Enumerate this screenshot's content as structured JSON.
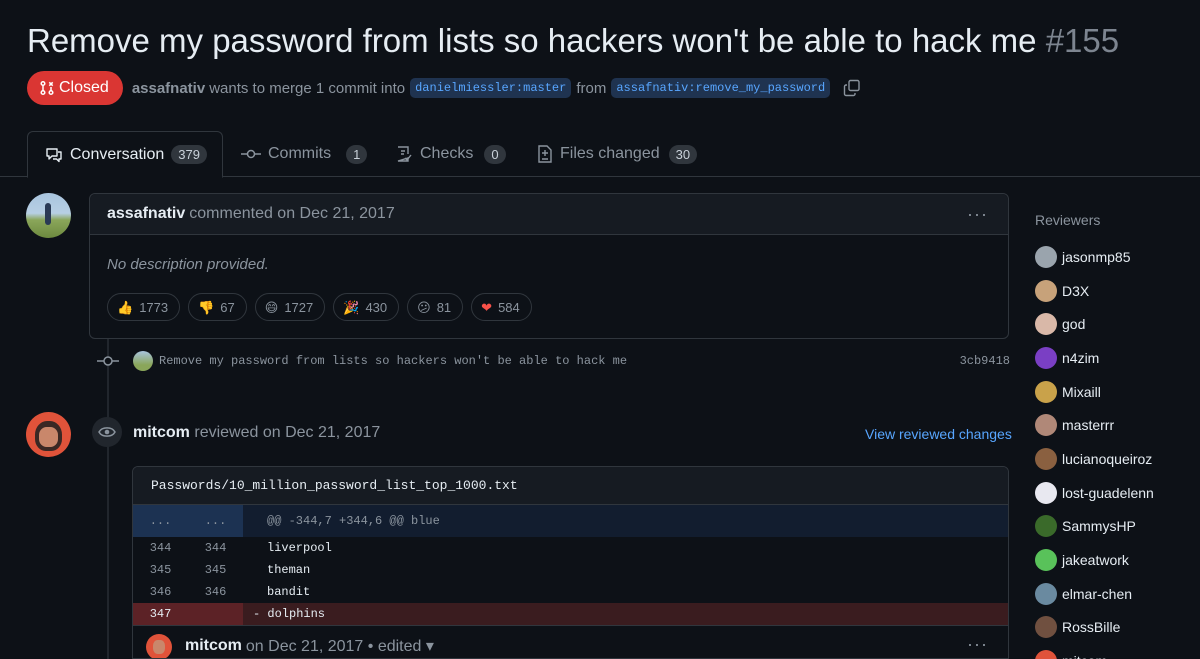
{
  "pr": {
    "title": "Remove my password from lists so hackers won't be able to hack me",
    "number": "#155",
    "state": "Closed",
    "author": "assafnativ",
    "merge_text": "wants to merge 1 commit into",
    "base_branch": "danielmiessler:master",
    "from_text": "from",
    "head_branch": "assafnativ:remove_my_password"
  },
  "tabs": [
    {
      "label": "Conversation",
      "count": "379",
      "icon": "conversation-icon"
    },
    {
      "label": "Commits",
      "count": "1",
      "icon": "commit-icon"
    },
    {
      "label": "Checks",
      "count": "0",
      "icon": "checklist-icon"
    },
    {
      "label": "Files changed",
      "count": "30",
      "icon": "file-diff-icon"
    }
  ],
  "comment": {
    "author": "assafnativ",
    "meta": "commented on Dec 21, 2017",
    "menu": "···",
    "body": "No description provided.",
    "reactions": [
      {
        "emoji": "👍",
        "count": "1773",
        "name": "thumbs-up"
      },
      {
        "emoji": "👎",
        "count": "67",
        "name": "thumbs-down"
      },
      {
        "emoji": "😄",
        "count": "1727",
        "name": "laugh"
      },
      {
        "emoji": "🎉",
        "count": "430",
        "name": "hooray"
      },
      {
        "emoji": "😕",
        "count": "81",
        "name": "confused"
      },
      {
        "emoji": "❤",
        "count": "584",
        "name": "heart"
      }
    ]
  },
  "commit": {
    "message": "Remove my password from lists so hackers won't be able to hack me",
    "sha": "3cb9418"
  },
  "review": {
    "author": "mitcom",
    "meta": "reviewed on Dec 21, 2017",
    "link": "View reviewed changes",
    "file": "Passwords/10_million_password_list_top_1000.txt",
    "hunk": {
      "left": "...",
      "right": "...",
      "header": "@@ -344,7 +344,6 @@ blue"
    },
    "lines": [
      {
        "old": "344",
        "new": "344",
        "code": "liverpool"
      },
      {
        "old": "345",
        "new": "345",
        "code": "theman"
      },
      {
        "old": "346",
        "new": "346",
        "code": "bandit"
      }
    ],
    "deleted": {
      "old": "347",
      "new": "",
      "code": "- dolphins"
    },
    "sub_comment": {
      "author": "mitcom",
      "meta": "on Dec 21, 2017 • edited ▾",
      "menu": "···"
    }
  },
  "sidebar": {
    "title": "Reviewers",
    "reviewers": [
      {
        "name": "jasonmp85",
        "color": "#9aa4ad"
      },
      {
        "name": "D3X",
        "color": "#c7a27a"
      },
      {
        "name": "god",
        "color": "#d9b8a8"
      },
      {
        "name": "n4zim",
        "color": "#7a3fc4"
      },
      {
        "name": "Mixaill",
        "color": "#c9a24a"
      },
      {
        "name": "masterrr",
        "color": "#b08878"
      },
      {
        "name": "lucianoqueiroz",
        "color": "#8a6040"
      },
      {
        "name": "lost-guadelenn",
        "color": "#e8e8f0"
      },
      {
        "name": "SammysHP",
        "color": "#3a6a2a"
      },
      {
        "name": "jakeatwork",
        "color": "#59c25a"
      },
      {
        "name": "elmar-chen",
        "color": "#6a8aa0"
      },
      {
        "name": "RossBille",
        "color": "#705040"
      },
      {
        "name": "mitcom",
        "color": "#e0533a"
      }
    ]
  }
}
